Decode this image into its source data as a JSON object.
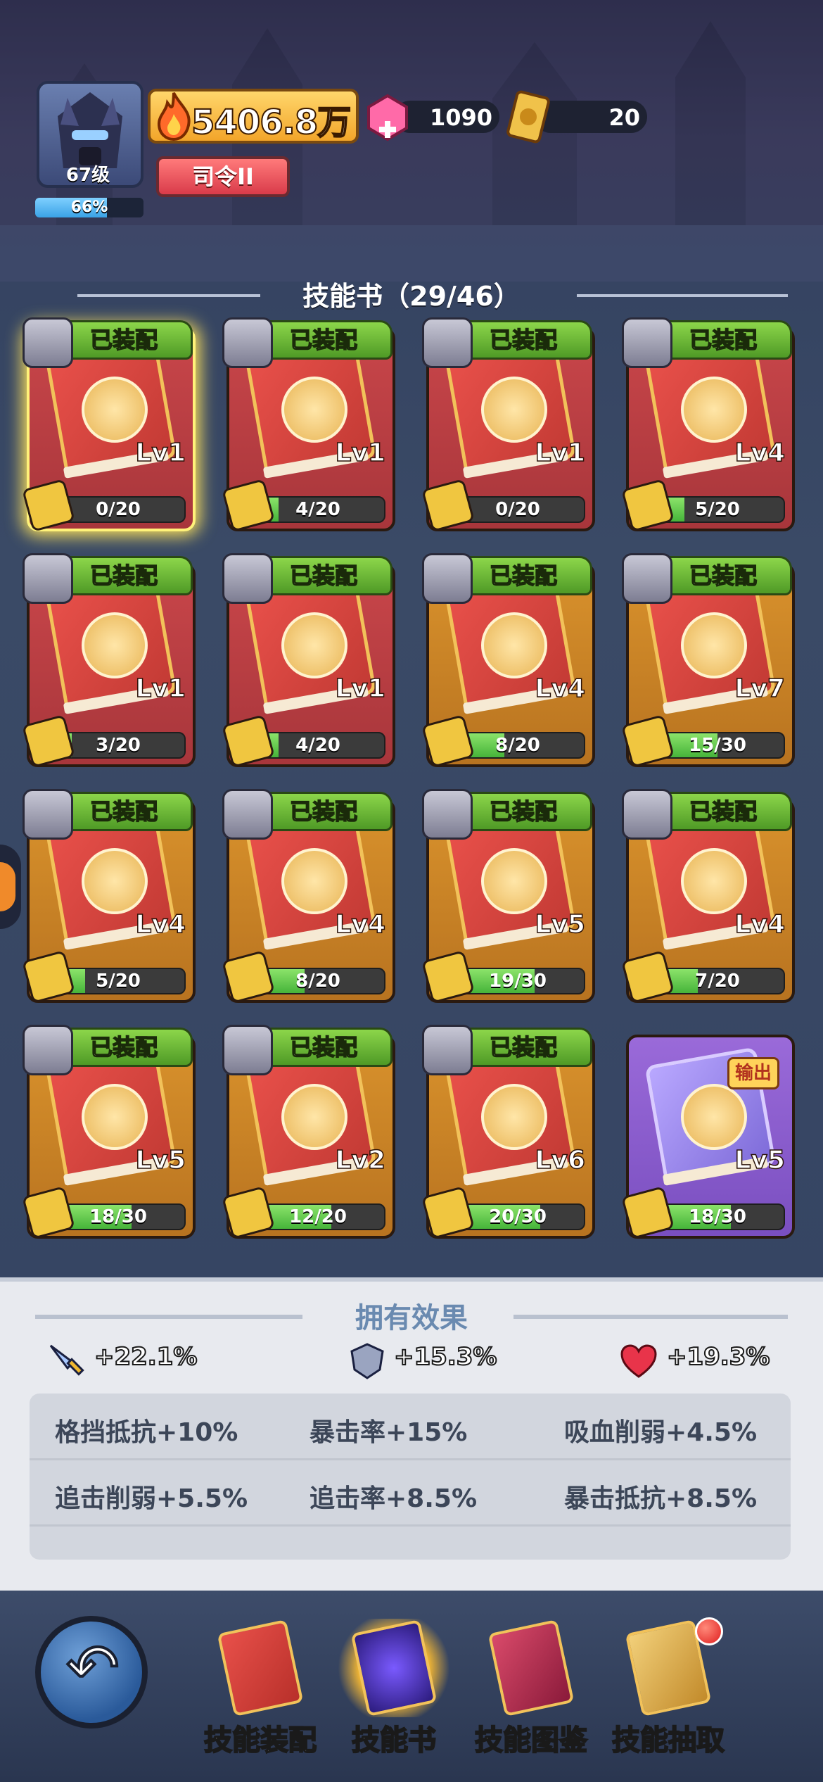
{
  "header": {
    "level": "67级",
    "exp_percent": "66%",
    "exp_fraction": 0.66,
    "power": "5406.8万",
    "rank": "司令II",
    "gems": "1090",
    "tickets": "20"
  },
  "section": {
    "title": "技能书（29/46）"
  },
  "cards": [
    {
      "equipped": "已装配",
      "level": "Lv1",
      "progress": "0/20",
      "fill": 0.0,
      "color": "red",
      "glow": true
    },
    {
      "equipped": "已装配",
      "level": "Lv1",
      "progress": "4/20",
      "fill": 0.2,
      "color": "red"
    },
    {
      "equipped": "已装配",
      "level": "Lv1",
      "progress": "0/20",
      "fill": 0.0,
      "color": "red"
    },
    {
      "equipped": "已装配",
      "level": "Lv4",
      "progress": "5/20",
      "fill": 0.25,
      "color": "red"
    },
    {
      "equipped": "已装配",
      "level": "Lv1",
      "progress": "3/20",
      "fill": 0.15,
      "color": "red"
    },
    {
      "equipped": "已装配",
      "level": "Lv1",
      "progress": "4/20",
      "fill": 0.2,
      "color": "red"
    },
    {
      "equipped": "已装配",
      "level": "Lv4",
      "progress": "8/20",
      "fill": 0.4,
      "color": "gold"
    },
    {
      "equipped": "已装配",
      "level": "Lv7",
      "progress": "15/30",
      "fill": 0.5,
      "color": "gold"
    },
    {
      "equipped": "已装配",
      "level": "Lv4",
      "progress": "5/20",
      "fill": 0.25,
      "color": "gold"
    },
    {
      "equipped": "已装配",
      "level": "Lv4",
      "progress": "8/20",
      "fill": 0.4,
      "color": "gold"
    },
    {
      "equipped": "已装配",
      "level": "Lv5",
      "progress": "19/30",
      "fill": 0.633,
      "color": "gold"
    },
    {
      "equipped": "已装配",
      "level": "Lv4",
      "progress": "7/20",
      "fill": 0.35,
      "color": "gold"
    },
    {
      "equipped": "已装配",
      "level": "Lv5",
      "progress": "18/30",
      "fill": 0.6,
      "color": "gold"
    },
    {
      "equipped": "已装配",
      "level": "Lv2",
      "progress": "12/20",
      "fill": 0.6,
      "color": "gold"
    },
    {
      "equipped": "已装配",
      "level": "Lv6",
      "progress": "20/30",
      "fill": 0.667,
      "color": "gold"
    },
    {
      "equipped": "",
      "level": "Lv5",
      "progress": "18/30",
      "fill": 0.6,
      "color": "purple",
      "type": "输出"
    }
  ],
  "effects": {
    "title": "拥有效果",
    "attack": "+22.1%",
    "defense": "+15.3%",
    "hp": "+19.3%",
    "stats": [
      "格挡抵抗+10%",
      "暴击率+15%",
      "吸血削弱+4.5%",
      "追击削弱+5.5%",
      "追击率+8.5%",
      "暴击抵抗+8.5%"
    ]
  },
  "nav": {
    "items": [
      "技能装配",
      "技能书",
      "技能图鉴",
      "技能抽取"
    ],
    "active": "技能书"
  }
}
